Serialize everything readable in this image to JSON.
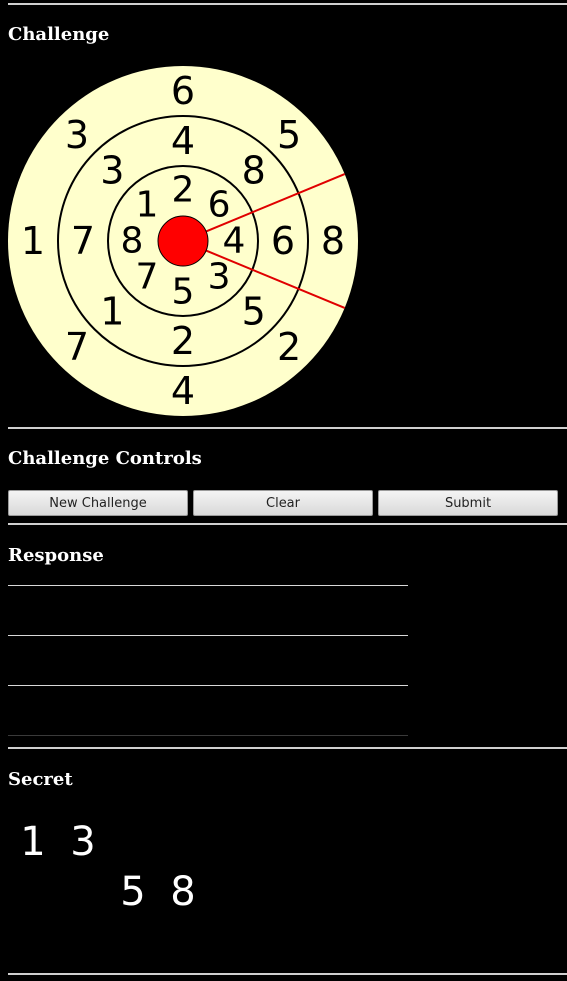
{
  "sections": {
    "challenge": "Challenge",
    "controls": "Challenge Controls",
    "response": "Response",
    "secret": "Secret"
  },
  "buttons": {
    "new_challenge": "New Challenge",
    "clear": "Clear",
    "submit": "Submit"
  },
  "board": {
    "colors": {
      "face": "#ffffcc",
      "ring_stroke": "#000000",
      "center": "#ff0000",
      "pointer": "#e00000",
      "digit": "#000000"
    },
    "rings": [
      {
        "name": "outer",
        "digits": [
          "6",
          "5",
          "8",
          "2",
          "4",
          "7",
          "1",
          "3"
        ]
      },
      {
        "name": "middle",
        "digits": [
          "4",
          "8",
          "6",
          "5",
          "2",
          "1",
          "7",
          "3"
        ]
      },
      {
        "name": "inner",
        "digits": [
          "2",
          "6",
          "4",
          "3",
          "5",
          "7",
          "8",
          "1"
        ]
      }
    ],
    "pointer_sector": "right"
  },
  "response": {
    "lines": [
      "",
      "",
      "",
      ""
    ]
  },
  "secret": {
    "rows": [
      [
        "1",
        "3",
        "",
        ""
      ],
      [
        "",
        "",
        "5",
        "8"
      ]
    ]
  }
}
